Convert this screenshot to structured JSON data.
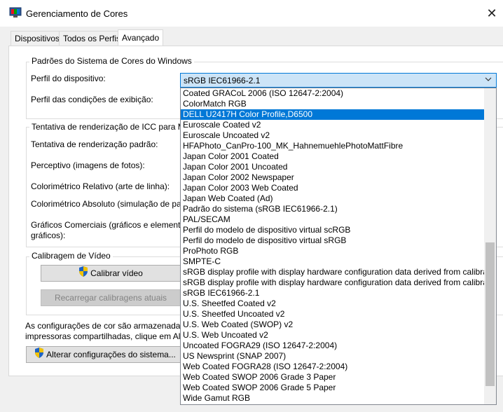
{
  "window": {
    "title": "Gerenciamento de Cores"
  },
  "tabs": [
    {
      "label": "Dispositivos"
    },
    {
      "label": "Todos os Perfis"
    },
    {
      "label": "Avançado"
    }
  ],
  "defaults_group": {
    "title": "Padrões do Sistema de Cores do Windows",
    "device_profile_label": "Perfil do dispositivo:",
    "viewing_conditions_label": "Perfil das condições de exibição:"
  },
  "combo": {
    "value": "sRGB IEC61966-2.1"
  },
  "dropdown_items": [
    "Coated GRACoL 2006 (ISO 12647-2:2004)",
    "ColorMatch RGB",
    "DELL U2417H Color Profile,D6500",
    "Euroscale Coated v2",
    "Euroscale Uncoated v2",
    "HFAPhoto_CanPro-100_MK_HahnemuehlePhotoMattFibre",
    "Japan Color 2001 Coated",
    "Japan Color 2001 Uncoated",
    "Japan Color 2002 Newspaper",
    "Japan Color 2003 Web Coated",
    "Japan Web Coated (Ad)",
    "Padrão do sistema (sRGB IEC61966-2.1)",
    "PAL/SECAM",
    "Perfil do modelo de dispositivo virtual scRGB",
    "Perfil do modelo de dispositivo virtual sRGB",
    "ProPhoto RGB",
    "SMPTE-C",
    "sRGB display profile with display hardware configuration data derived from calibra",
    "sRGB display profile with display hardware configuration data derived from calibra",
    "sRGB IEC61966-2.1",
    "U.S. Sheetfed Coated v2",
    "U.S. Sheetfed Uncoated v2",
    "U.S. Web Coated (SWOP) v2",
    "U.S. Web Uncoated v2",
    "Uncoated FOGRA29 (ISO 12647-2:2004)",
    "US Newsprint (SNAP 2007)",
    "Web Coated FOGRA28 (ISO 12647-2:2004)",
    "Web Coated SWOP 2006 Grade 3 Paper",
    "Web Coated SWOP 2006 Grade 5 Paper",
    "Wide Gamut RGB"
  ],
  "selected_item": "DELL U2417H Color Profile,D6500",
  "rendering_group": {
    "title": "Tentativa de renderização de ICC para Ma",
    "default_label": "Tentativa de renderização padrão:",
    "perceptual_label": "Perceptivo (imagens de fotos):",
    "relative_label": "Colorimétrico Relativo (arte de linha):",
    "absolute_label": "Colorimétrico Absoluto (simulação de pa",
    "business_label_1": "Gráficos Comerciais (gráficos e elemento",
    "business_label_2": "gráficos):"
  },
  "calibration_group": {
    "title": "Calibragem de Vídeo",
    "calibrate_button": "Calibrar vídeo",
    "reload_button": "Recarregar calibragens atuais"
  },
  "footer": {
    "text_line1": "As configurações de cor são armazenada",
    "text_line2": "impressoras compartilhadas, clique em Alt",
    "change_button": "Alterar configurações do sistema..."
  },
  "colors": {
    "accent": "#0078d7",
    "selection": "#0078d7"
  },
  "icons": {
    "app": "color-management-icon",
    "shield": "uac-shield-icon",
    "close": "close-icon",
    "dropdown": "chevron-down-icon"
  }
}
